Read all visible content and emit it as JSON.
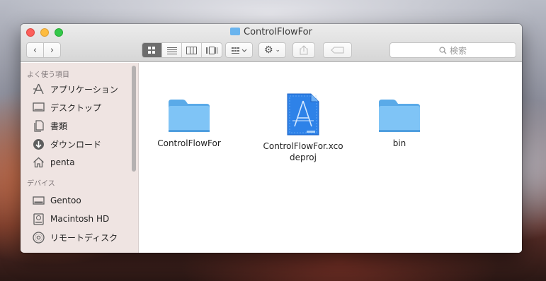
{
  "window": {
    "title": "ControlFlowFor"
  },
  "toolbar": {
    "back_icon": "chevron-left-icon",
    "forward_icon": "chevron-right-icon",
    "views": [
      "icon-view",
      "list-view",
      "column-view",
      "coverflow-view"
    ],
    "active_view": "icon-view",
    "search_placeholder": "検索"
  },
  "sidebar": {
    "favorites_header": "よく使う項目",
    "favorites": [
      {
        "label": "アプリケーション",
        "icon": "applications-icon"
      },
      {
        "label": "デスクトップ",
        "icon": "desktop-icon"
      },
      {
        "label": "書類",
        "icon": "documents-icon"
      },
      {
        "label": "ダウンロード",
        "icon": "downloads-icon"
      },
      {
        "label": "penta",
        "icon": "home-icon"
      }
    ],
    "devices_header": "デバイス",
    "devices": [
      {
        "label": "Gentoo",
        "icon": "disk-icon"
      },
      {
        "label": "Macintosh HD",
        "icon": "hard-drive-icon"
      },
      {
        "label": "リモートディスク",
        "icon": "optical-disk-icon"
      }
    ]
  },
  "files": [
    {
      "name": "ControlFlowFor",
      "kind": "folder-icon"
    },
    {
      "name": "ControlFlowFor.xcodeproj",
      "kind": "xcode-project-icon"
    },
    {
      "name": "bin",
      "kind": "folder-icon"
    }
  ],
  "colors": {
    "folder": "#6ab4ee",
    "sidebar_bg": "#efe4e2",
    "xcode_blue": "#2e82e8"
  }
}
